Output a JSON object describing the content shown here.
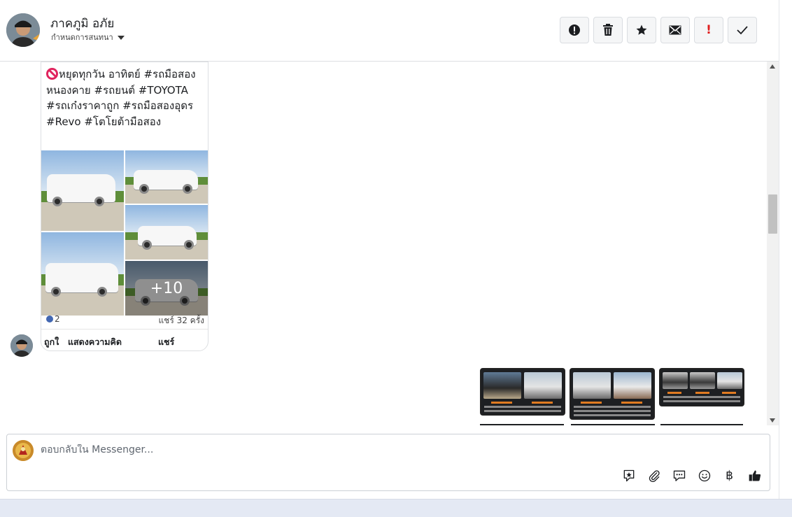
{
  "header": {
    "user_name": "ภาคภูมิ อภัย",
    "conversation_settings": "กำหนดการสนทนา",
    "toolbar": [
      {
        "name": "report-icon",
        "glyph": "!",
        "title": "report"
      },
      {
        "name": "trash-icon",
        "glyph": "🗑",
        "title": "delete"
      },
      {
        "name": "star-icon",
        "glyph": "★",
        "title": "star"
      },
      {
        "name": "envelope-icon",
        "glyph": "✉",
        "title": "mark unread"
      },
      {
        "name": "important-icon",
        "glyph": "!",
        "title": "important"
      },
      {
        "name": "check-icon",
        "glyph": "✓",
        "title": "done"
      }
    ]
  },
  "post": {
    "text": "หยุดทุกวัน อาทิตย์ #รถมือสองหนองคาย #รถยนต์ #TOYOTA  #รถเก๋งราคาถูก #รถมือสองอุดร #Revo  #โตโยต้ามือสอง",
    "more_photos": "+10",
    "reactions": "2",
    "shares": "แชร์ 32 ครั้ง",
    "actions": {
      "like": "ถูกใ",
      "comment": "แสดงความคิด",
      "share": "แชร์"
    }
  },
  "composer": {
    "placeholder": "ตอบกลับใน Messenger...",
    "icons": [
      "sticker-icon",
      "paperclip-icon",
      "chat-bubble-icon",
      "emoji-icon",
      "baht-icon",
      "thumbs-up-icon"
    ],
    "baht_symbol": "฿"
  },
  "colors": {
    "accent": "#4267b2",
    "important": "#e02020",
    "no_sign": "#e0245e"
  }
}
